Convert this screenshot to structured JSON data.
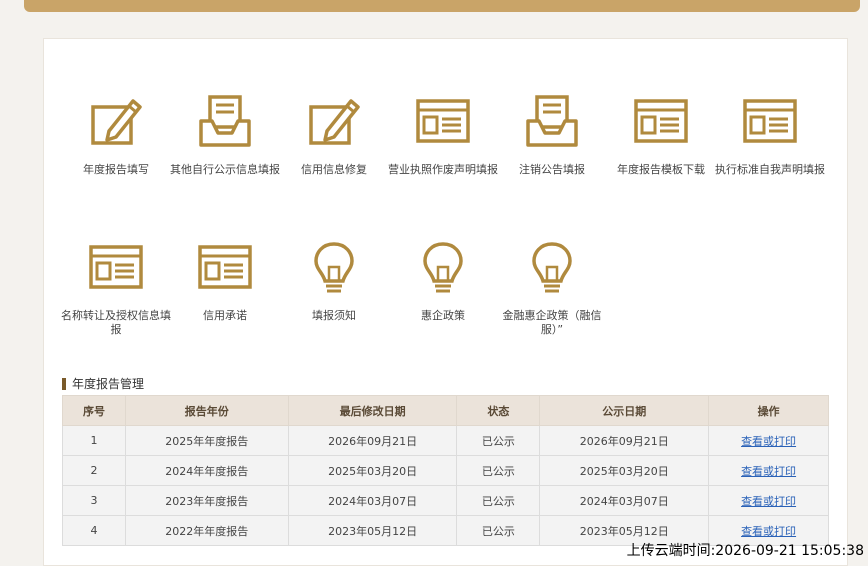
{
  "tiles": [
    {
      "label": "年度报告填写",
      "icon": "edit-icon"
    },
    {
      "label": "其他自行公示信息填报",
      "icon": "inbox-icon"
    },
    {
      "label": "信用信息修复",
      "icon": "edit-icon"
    },
    {
      "label": "营业执照作废声明填报",
      "icon": "window-icon"
    },
    {
      "label": "注销公告填报",
      "icon": "inbox-icon"
    },
    {
      "label": "年度报告模板下载",
      "icon": "window-icon"
    },
    {
      "label": "执行标准自我声明填报",
      "icon": "window-icon"
    },
    {
      "label": "名称转让及授权信息填报",
      "icon": "window-icon"
    },
    {
      "label": "信用承诺",
      "icon": "window-icon"
    },
    {
      "label": "填报须知",
      "icon": "lightbulb-icon"
    },
    {
      "label": "惠企政策",
      "icon": "lightbulb-icon"
    },
    {
      "label": "金融惠企政策（融信服）”",
      "icon": "lightbulb-icon"
    }
  ],
  "section": {
    "title": "年度报告管理"
  },
  "table": {
    "headers": [
      "序号",
      "报告年份",
      "最后修改日期",
      "状态",
      "公示日期",
      "操作"
    ],
    "rows": [
      [
        "1",
        "2025年年度报告",
        "2026年09月21日",
        "已公示",
        "2026年09月21日",
        "查看或打印"
      ],
      [
        "2",
        "2024年年度报告",
        "2025年03月20日",
        "已公示",
        "2025年03月20日",
        "查看或打印"
      ],
      [
        "3",
        "2023年年度报告",
        "2024年03月07日",
        "已公示",
        "2024年03月07日",
        "查看或打印"
      ],
      [
        "4",
        "2022年年度报告",
        "2023年05月12日",
        "已公示",
        "2023年05月12日",
        "查看或打印"
      ]
    ]
  },
  "footer": {
    "upload_time": "上传云端时间:2026-09-21 15:05:38"
  },
  "colors": {
    "accent": "#b08a3e",
    "header_bg": "#ebe3da",
    "link": "#2a62b8"
  }
}
